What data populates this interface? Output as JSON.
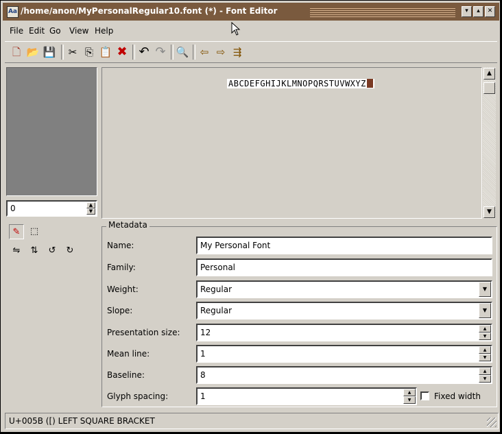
{
  "window": {
    "title": "/home/anon/MyPersonalRegular10.font (*) - Font Editor",
    "app_icon": "Aa",
    "controls": {
      "minimize": "▾",
      "maximize": "▴",
      "close": "✕"
    }
  },
  "menubar": {
    "items": [
      "File",
      "Edit",
      "Go",
      "View",
      "Help"
    ]
  },
  "toolbar": {
    "buttons": [
      {
        "name": "new-font",
        "icon": "new-document-icon",
        "glyph": "🗋"
      },
      {
        "name": "open",
        "icon": "open-folder-icon",
        "glyph": "📂"
      },
      {
        "name": "save",
        "icon": "save-disk-icon",
        "glyph": "💾"
      },
      {
        "name": "cut",
        "icon": "scissors-icon",
        "glyph": "✂"
      },
      {
        "name": "copy",
        "icon": "copy-icon",
        "glyph": "⎘"
      },
      {
        "name": "paste",
        "icon": "clipboard-icon",
        "glyph": "📋"
      },
      {
        "name": "delete",
        "icon": "red-x-icon",
        "glyph": "✖"
      },
      {
        "name": "undo",
        "icon": "undo-icon",
        "glyph": "↶"
      },
      {
        "name": "redo",
        "icon": "redo-icon",
        "glyph": "↷"
      },
      {
        "name": "find",
        "icon": "magnifier-icon",
        "glyph": "🔍"
      },
      {
        "name": "back",
        "icon": "left-arrow-icon",
        "glyph": "⇦"
      },
      {
        "name": "forward",
        "icon": "right-arrow-icon",
        "glyph": "⇨"
      },
      {
        "name": "goto",
        "icon": "goto-arrow-icon",
        "glyph": "⇶"
      }
    ]
  },
  "glyph_panel": {
    "index_value": "0"
  },
  "canvas": {
    "sample_text": "ABCDEFGHIJKLMNOPQRSTUVWXYZ"
  },
  "tools": {
    "row1": [
      {
        "name": "pencil",
        "icon": "pencil-icon",
        "glyph": "✎"
      },
      {
        "name": "select",
        "icon": "selection-icon",
        "glyph": "⬚"
      }
    ],
    "row2": [
      {
        "name": "flip-horizontal",
        "icon": "flip-horizontal-icon",
        "glyph": "⇋"
      },
      {
        "name": "flip-vertical",
        "icon": "flip-vertical-icon",
        "glyph": "⇅"
      },
      {
        "name": "rotate-ccw",
        "icon": "rotate-ccw-90-icon",
        "glyph": "↺"
      },
      {
        "name": "rotate-cw",
        "icon": "rotate-cw-90-icon",
        "glyph": "↻"
      }
    ]
  },
  "metadata": {
    "group_title": "Metadata",
    "name_label": "Name:",
    "name_value": "My Personal Font",
    "family_label": "Family:",
    "family_value": "Personal",
    "weight_label": "Weight:",
    "weight_value": "Regular",
    "slope_label": "Slope:",
    "slope_value": "Regular",
    "presentation_size_label": "Presentation size:",
    "presentation_size_value": "12",
    "mean_line_label": "Mean line:",
    "mean_line_value": "1",
    "baseline_label": "Baseline:",
    "baseline_value": "8",
    "glyph_spacing_label": "Glyph spacing:",
    "glyph_spacing_value": "1",
    "fixed_width_label": "Fixed width",
    "fixed_width_checked": false
  },
  "statusbar": {
    "text": "U+005B ([) LEFT SQUARE BRACKET"
  }
}
